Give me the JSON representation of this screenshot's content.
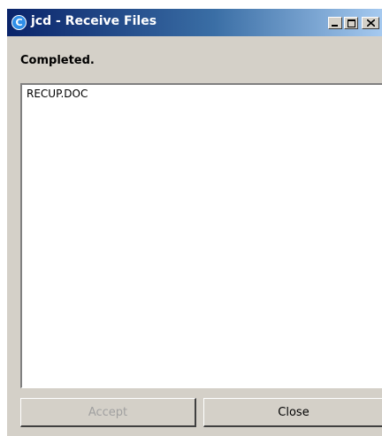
{
  "window": {
    "title": "jcd - Receive Files",
    "app_icon_glyph": "C",
    "icon": "app-icon",
    "caption_buttons": [
      "minimize",
      "maximize",
      "close"
    ]
  },
  "status": {
    "text": "Completed."
  },
  "file_list": {
    "items": [
      "RECUP.DOC"
    ]
  },
  "buttons": {
    "accept_label": "Accept",
    "accept_enabled": false,
    "close_label": "Close"
  },
  "colors": {
    "titlebar_start": "#0a246a",
    "titlebar_end": "#a6caf0",
    "window_bg": "#d4d0c8",
    "disabled_text": "#a0a0a0"
  }
}
